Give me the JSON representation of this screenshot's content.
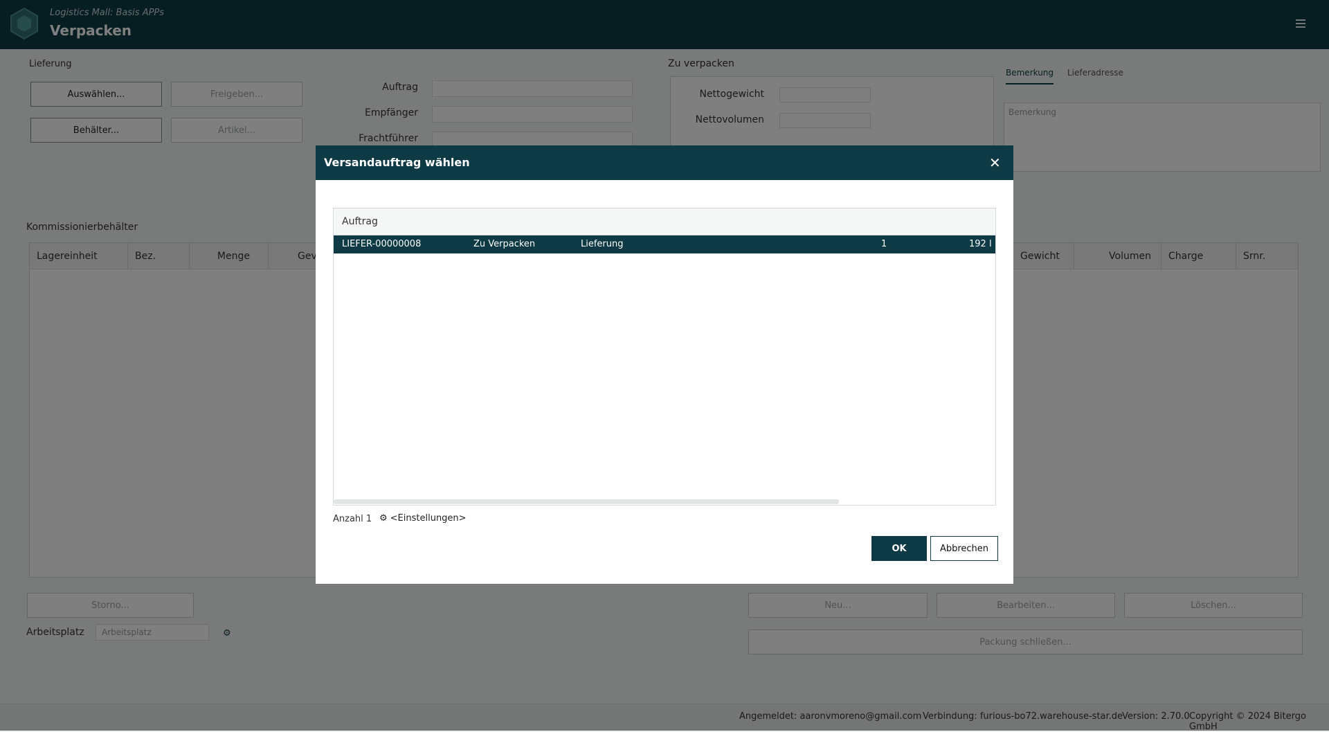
{
  "header": {
    "subtitle": "Logistics Mall: Basis APPs",
    "title": "Verpacken"
  },
  "lieferung": {
    "label": "Lieferung",
    "buttons": {
      "auswaehlen": "Auswählen...",
      "freigeben": "Freigeben...",
      "behaelter": "Behälter...",
      "artikel": "Artikel..."
    }
  },
  "fields": {
    "auftrag": "Auftrag",
    "empfaenger": "Empfänger",
    "frachtfuehrer": "Frachtführer"
  },
  "zu_verpacken": {
    "label": "Zu verpacken",
    "nettogewicht": "Nettogewicht",
    "nettovolumen": "Nettovolumen"
  },
  "tabs": {
    "bemerkung": "Bemerkung",
    "lieferadresse": "Lieferadresse",
    "bemerkung_placeholder": "Bemerkung"
  },
  "kommissionierbehaelter": {
    "label": "Kommissionierbehälter",
    "columns_left": [
      "Lagereinheit",
      "Bez.",
      "Menge",
      "Gev"
    ],
    "columns_right": [
      "Gewicht",
      "Volumen",
      "Charge",
      "Srnr."
    ]
  },
  "bottom": {
    "storno": "Storno...",
    "arbeitsplatz_label": "Arbeitsplatz",
    "arbeitsplatz_placeholder": "Arbeitsplatz",
    "neu": "Neu...",
    "bearbeiten": "Bearbeiten...",
    "loeschen": "Löschen...",
    "packung_schliessen": "Packung schließen..."
  },
  "footer": {
    "user": "Angemeldet: aaronvmoreno@gmail.com",
    "connection": "Verbindung: furious-bo72.warehouse-star.de",
    "version": "Version: 2.70.0",
    "copyright": "Copyright © 2024 Bitergo GmbH"
  },
  "dialog": {
    "title": "Versandauftrag wählen",
    "list_header": "Auftrag",
    "rows": [
      {
        "id": "LIEFER-00000008",
        "status": "Zu Verpacken",
        "type": "Lieferung",
        "qty": "1",
        "value": "192 l"
      }
    ],
    "count_label": "Anzahl 1",
    "settings_label": "<Einstellungen>",
    "ok": "OK",
    "cancel": "Abbrechen"
  },
  "colors": {
    "primary": "#0d3a45"
  }
}
